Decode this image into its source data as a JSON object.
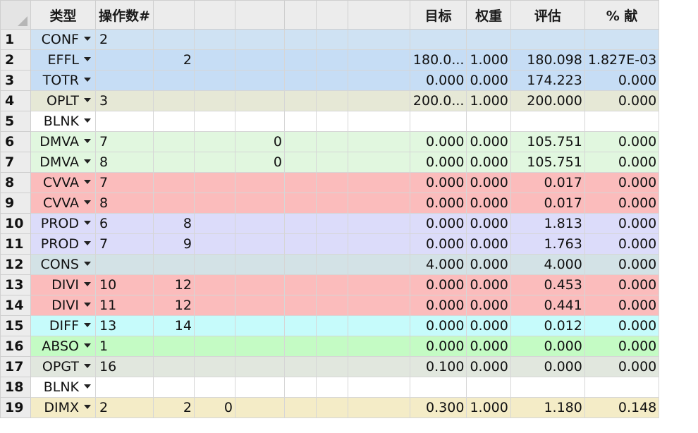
{
  "columns": [
    "类型",
    "操作数#",
    "",
    "",
    "",
    "",
    "",
    "",
    "目标",
    "权重",
    "评估",
    "% 献"
  ],
  "colors": {
    "CONF": "#cfe2f3",
    "EFFL": "#c6ddf5",
    "TOTR": "#c6ddf5",
    "OPLT": "#e6e8d6",
    "BLNK": "#ffffff",
    "DMVA": "#e1f7df",
    "CVVA": "#fbbcbc",
    "PROD": "#dcdcfa",
    "CONS": "#d3e2e6",
    "DIVI": "#fbbcbc",
    "DIFF": "#c6fbfb",
    "ABSO": "#c4fbc4",
    "OPGT": "#e1e7de",
    "DIMX": "#f4ecc7"
  },
  "rows": [
    {
      "num": "1",
      "type": "CONF",
      "c": [
        "2",
        "",
        "",
        "",
        "",
        "",
        "",
        "",
        "",
        "",
        ""
      ]
    },
    {
      "num": "2",
      "type": "EFFL",
      "c": [
        "",
        "2",
        "",
        "",
        "",
        "",
        "",
        "180.0...",
        "1.000",
        "180.098",
        "1.827E-03"
      ]
    },
    {
      "num": "3",
      "type": "TOTR",
      "c": [
        "",
        "",
        "",
        "",
        "",
        "",
        "",
        "0.000",
        "0.000",
        "174.223",
        "0.000"
      ]
    },
    {
      "num": "4",
      "type": "OPLT",
      "c": [
        "3",
        "",
        "",
        "",
        "",
        "",
        "",
        "200.0...",
        "1.000",
        "200.000",
        "0.000"
      ]
    },
    {
      "num": "5",
      "type": "BLNK",
      "c": [
        "",
        "",
        "",
        "",
        "",
        "",
        "",
        "",
        "",
        "",
        ""
      ]
    },
    {
      "num": "6",
      "type": "DMVA",
      "c": [
        "7",
        "",
        "",
        "0",
        "",
        "",
        "",
        "0.000",
        "0.000",
        "105.751",
        "0.000"
      ]
    },
    {
      "num": "7",
      "type": "DMVA",
      "c": [
        "8",
        "",
        "",
        "0",
        "",
        "",
        "",
        "0.000",
        "0.000",
        "105.751",
        "0.000"
      ]
    },
    {
      "num": "8",
      "type": "CVVA",
      "c": [
        "7",
        "",
        "",
        "",
        "",
        "",
        "",
        "0.000",
        "0.000",
        "0.017",
        "0.000"
      ]
    },
    {
      "num": "9",
      "type": "CVVA",
      "c": [
        "8",
        "",
        "",
        "",
        "",
        "",
        "",
        "0.000",
        "0.000",
        "0.017",
        "0.000"
      ]
    },
    {
      "num": "10",
      "type": "PROD",
      "c": [
        "6",
        "8",
        "",
        "",
        "",
        "",
        "",
        "0.000",
        "0.000",
        "1.813",
        "0.000"
      ]
    },
    {
      "num": "11",
      "type": "PROD",
      "c": [
        "7",
        "9",
        "",
        "",
        "",
        "",
        "",
        "0.000",
        "0.000",
        "1.763",
        "0.000"
      ]
    },
    {
      "num": "12",
      "type": "CONS",
      "c": [
        "",
        "",
        "",
        "",
        "",
        "",
        "",
        "4.000",
        "0.000",
        "4.000",
        "0.000"
      ]
    },
    {
      "num": "13",
      "type": "DIVI",
      "c": [
        "10",
        "12",
        "",
        "",
        "",
        "",
        "",
        "0.000",
        "0.000",
        "0.453",
        "0.000"
      ]
    },
    {
      "num": "14",
      "type": "DIVI",
      "c": [
        "11",
        "12",
        "",
        "",
        "",
        "",
        "",
        "0.000",
        "0.000",
        "0.441",
        "0.000"
      ]
    },
    {
      "num": "15",
      "type": "DIFF",
      "c": [
        "13",
        "14",
        "",
        "",
        "",
        "",
        "",
        "0.000",
        "0.000",
        "0.012",
        "0.000"
      ]
    },
    {
      "num": "16",
      "type": "ABSO",
      "c": [
        "1",
        "",
        "",
        "",
        "",
        "",
        "",
        "0.000",
        "0.000",
        "0.000",
        "0.000"
      ]
    },
    {
      "num": "17",
      "type": "OPGT",
      "c": [
        "16",
        "",
        "",
        "",
        "",
        "",
        "",
        "0.100",
        "0.000",
        "0.000",
        "0.000"
      ]
    },
    {
      "num": "18",
      "type": "BLNK",
      "c": [
        "",
        "",
        "",
        "",
        "",
        "",
        "",
        "",
        "",
        "",
        ""
      ]
    },
    {
      "num": "19",
      "type": "DIMX",
      "c": [
        "2",
        "2",
        "0",
        "",
        "",
        "",
        "",
        "0.300",
        "1.000",
        "1.180",
        "0.148"
      ]
    }
  ]
}
